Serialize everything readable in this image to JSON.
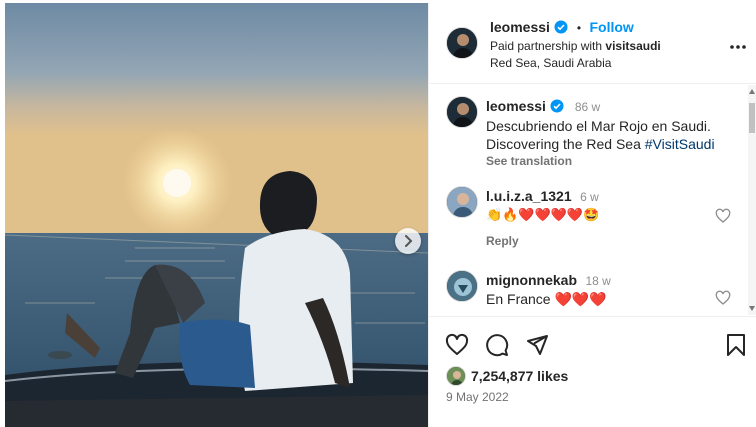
{
  "post": {
    "username": "leomessi",
    "follow_label": "Follow",
    "partnership_prefix": "Paid partnership with ",
    "partner": "visitsaudi",
    "location": "Red Sea, Saudi Arabia"
  },
  "caption": {
    "username": "leomessi",
    "age": "86 w",
    "line1": "Descubriendo el Mar Rojo en Saudi.",
    "line2": "Discovering the Red Sea ",
    "hashtag": "#VisitSaudi",
    "see_translation": "See translation"
  },
  "comments": [
    {
      "username": "l.u.i.z.a_1321",
      "age": "6 w",
      "text": "👏🔥❤️❤️❤️❤️🤩",
      "reply": "Reply"
    },
    {
      "username": "mignonnekab",
      "age": "18 w",
      "text": "En France ❤️❤️❤️"
    }
  ],
  "stats": {
    "likes": "7,254,877 likes",
    "date": "9 May 2022"
  },
  "colors": {
    "accent": "#0095f6",
    "verified": "#0095f6",
    "hashtag": "#00376b"
  }
}
